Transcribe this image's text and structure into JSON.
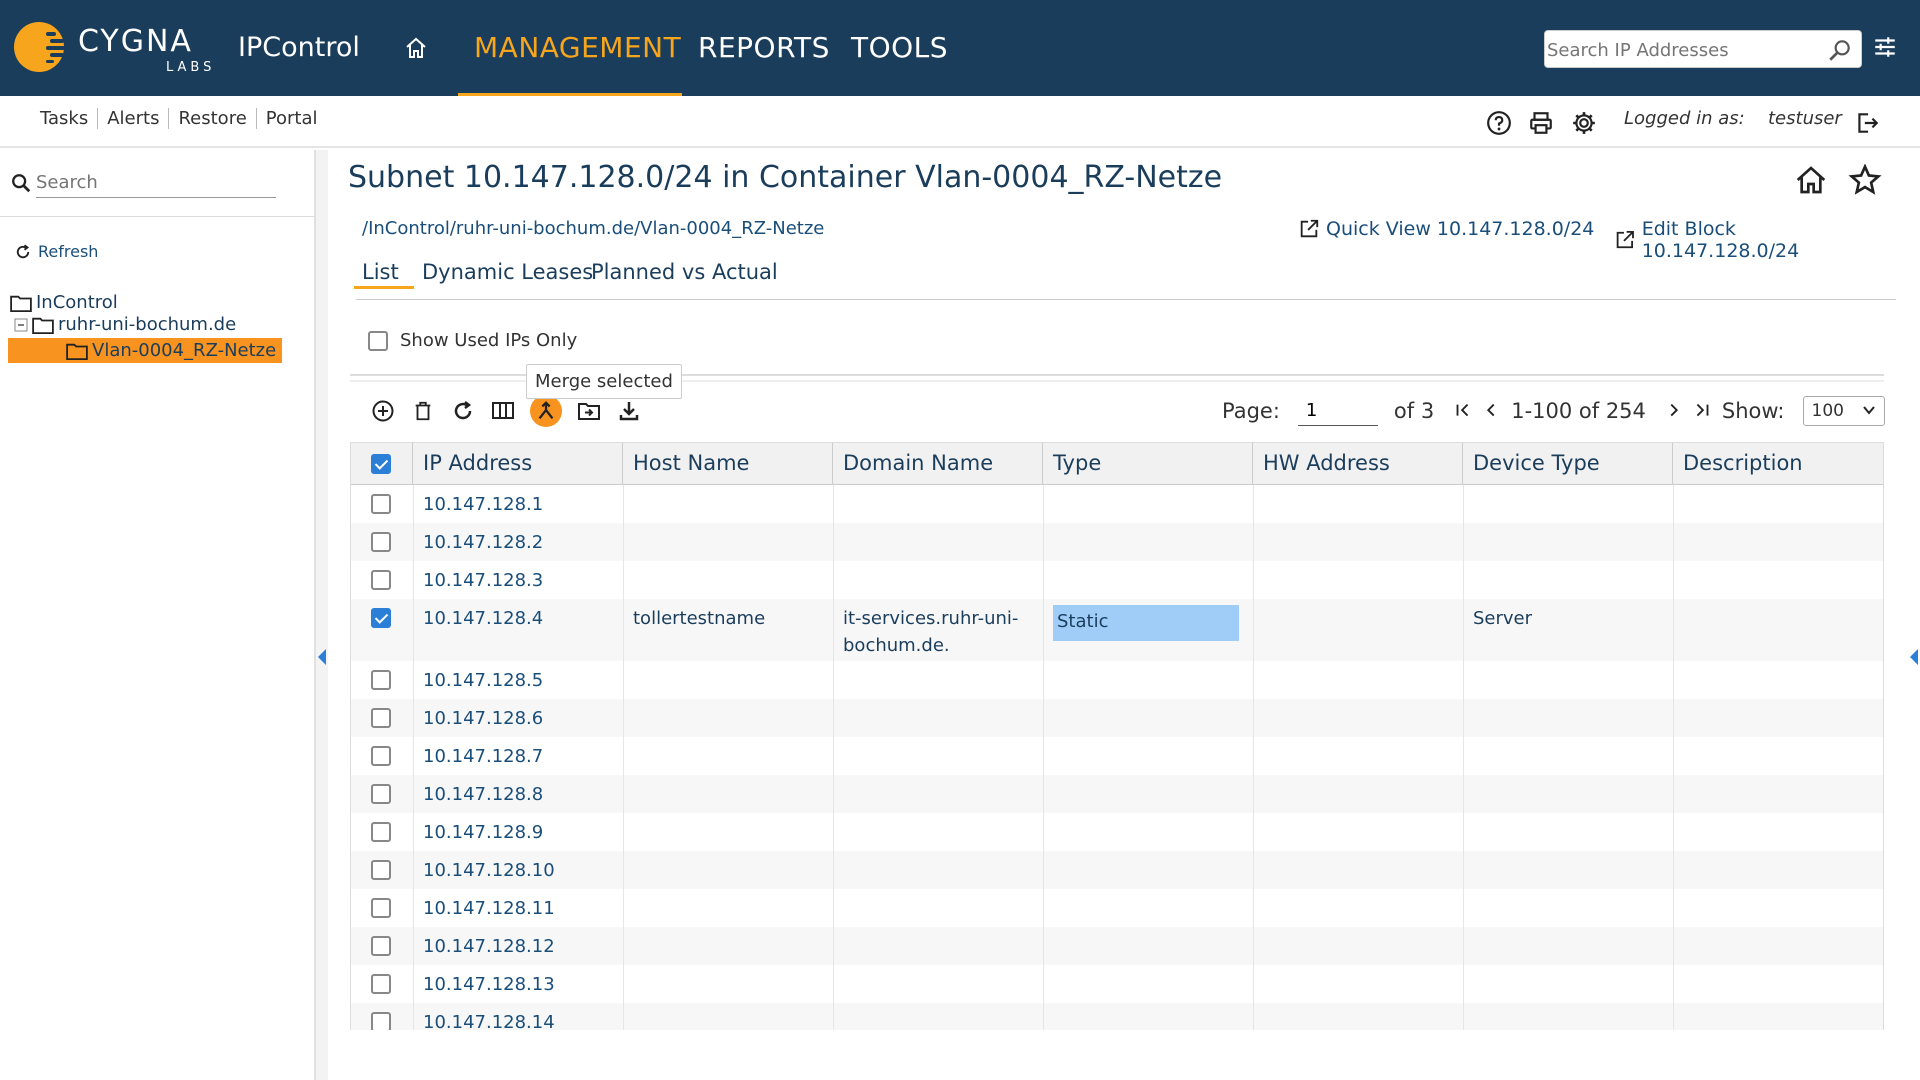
{
  "brand": {
    "word": "CYGNA",
    "sub": "LABS",
    "app": "IPControl"
  },
  "nav": {
    "management": "MANAGEMENT",
    "reports": "REPORTS",
    "tools": "TOOLS"
  },
  "top_search": {
    "placeholder": "Search IP Addresses"
  },
  "sublinks": [
    "Tasks",
    "Alerts",
    "Restore",
    "Portal"
  ],
  "user": {
    "logged_label": "Logged in as:",
    "name": "testuser"
  },
  "left": {
    "search_placeholder": "Search",
    "refresh": "Refresh",
    "tree": {
      "root": "InControl",
      "domain": "ruhr-uni-bochum.de",
      "container": "Vlan-0004_RZ-Netze"
    }
  },
  "main": {
    "title": "Subnet 10.147.128.0/24 in Container Vlan-0004_RZ-Netze",
    "breadcrumb": "/InControl/ruhr-uni-bochum.de/Vlan-0004_RZ-Netze",
    "quick_view": "Quick View 10.147.128.0/24",
    "edit_block": "Edit Block 10.147.128.0/24",
    "tabs": [
      "List",
      "Dynamic Leases",
      "Planned vs Actual"
    ],
    "show_used": "Show Used IPs Only",
    "tooltip": "Merge selected",
    "pager": {
      "page_label": "Page:",
      "page": "1",
      "of": "of 3",
      "range": "1-100 of 254",
      "show_label": "Show:",
      "show_value": "100"
    },
    "columns": [
      "IP Address",
      "Host Name",
      "Domain Name",
      "Type",
      "HW Address",
      "Device Type",
      "Description"
    ],
    "rows": [
      {
        "ip": "10.147.128.1"
      },
      {
        "ip": "10.147.128.2"
      },
      {
        "ip": "10.147.128.3"
      },
      {
        "ip": "10.147.128.4",
        "host": "tollertestname",
        "domain_l1": "it-services.ruhr-uni-",
        "domain_l2": "bochum.de.",
        "type": "Static",
        "device": "Server",
        "checked": true
      },
      {
        "ip": "10.147.128.5"
      },
      {
        "ip": "10.147.128.6"
      },
      {
        "ip": "10.147.128.7"
      },
      {
        "ip": "10.147.128.8"
      },
      {
        "ip": "10.147.128.9"
      },
      {
        "ip": "10.147.128.10"
      },
      {
        "ip": "10.147.128.11"
      },
      {
        "ip": "10.147.128.12"
      },
      {
        "ip": "10.147.128.13"
      },
      {
        "ip": "10.147.128.14"
      }
    ]
  },
  "colors": {
    "navbar": "#1b3d5c",
    "accent": "#f7a51c",
    "selected_tree": "#f7931e",
    "checkbox": "#2b7fd6",
    "type_chip": "#9fcdf7"
  }
}
